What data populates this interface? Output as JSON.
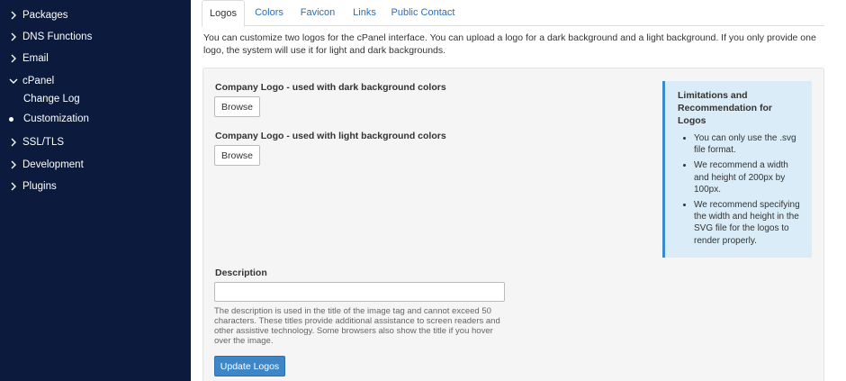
{
  "sidebar": {
    "items": [
      {
        "label": "Packages"
      },
      {
        "label": "DNS Functions"
      },
      {
        "label": "Email"
      },
      {
        "label": "cPanel"
      },
      {
        "label": "Change Log"
      },
      {
        "label": "Customization"
      },
      {
        "label": "SSL/TLS"
      },
      {
        "label": "Development"
      },
      {
        "label": "Plugins"
      }
    ]
  },
  "tabs": [
    {
      "label": "Logos"
    },
    {
      "label": "Colors"
    },
    {
      "label": "Favicon"
    },
    {
      "label": "Links"
    },
    {
      "label": "Public Contact"
    }
  ],
  "intro": "You can customize two logos for the cPanel interface. You can upload a logo for a dark background and a light background. If you only provide one logo, the system will use it for light and dark backgrounds.",
  "form": {
    "dark_logo_label": "Company Logo - used with dark background colors",
    "light_logo_label": "Company Logo - used with light background colors",
    "browse_label": "Browse",
    "description_label": "Description",
    "description_value": "",
    "description_help": "The description is used in the title of the image tag and cannot exceed 50 characters. These titles provide additional assistance to screen readers and other assistive technology. Some browsers also show the title if you hover over the image.",
    "update_label": "Update Logos"
  },
  "info": {
    "title": "Limitations and Recommendation for Logos",
    "items": [
      "You can only use the .svg file format.",
      "We recommend a width and height of 200px by 100px.",
      "We recommend specifying the width and height in the SVG file for the logos to render properly."
    ]
  },
  "colors": {
    "sidebar_bg": "#0b1a3d",
    "accent": "#3d87c9",
    "link": "#2a6fb5",
    "info_bg": "#d9ecf7"
  }
}
